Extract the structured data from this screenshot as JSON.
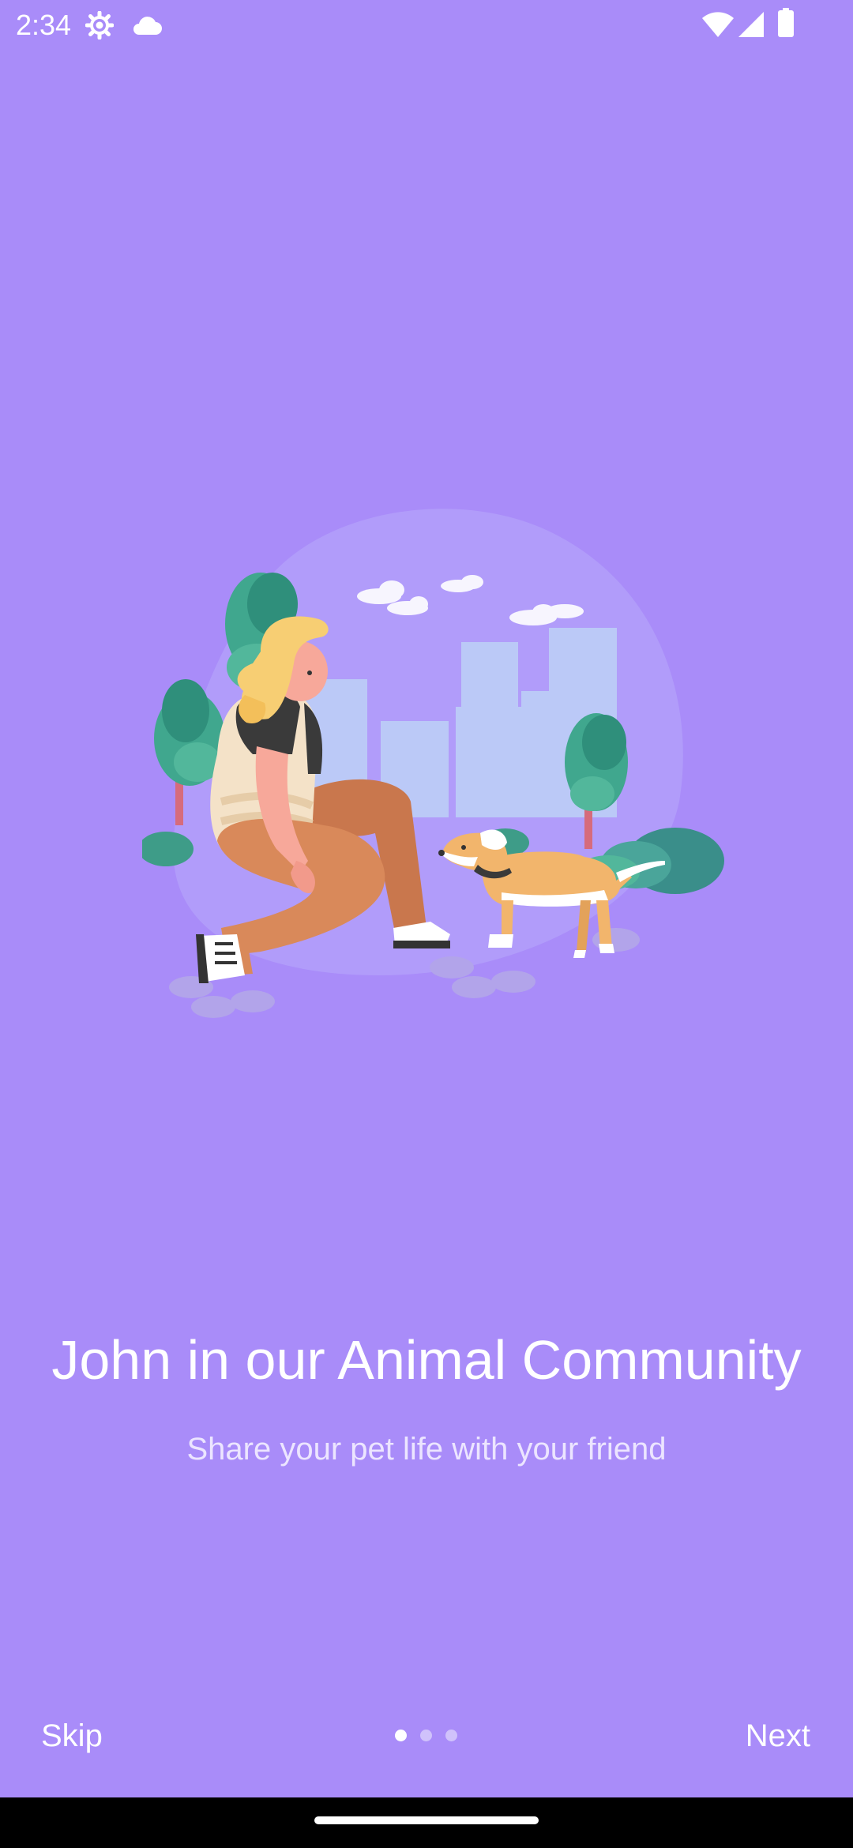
{
  "status_bar": {
    "time": "2:34",
    "icons": [
      "settings-icon",
      "cloud-icon",
      "wifi-icon",
      "signal-icon",
      "battery-icon"
    ]
  },
  "onboarding": {
    "illustration": "woman-petting-dog-in-park-illustration",
    "title": "John in our Animal Community",
    "subtitle": "Share your pet life with your friend",
    "page_indicator": {
      "current": 1,
      "total": 3
    }
  },
  "footer": {
    "skip_label": "Skip",
    "next_label": "Next"
  },
  "colors": {
    "background": "#a98cf9",
    "text": "#ffffff",
    "subtitle": "#ece5ff",
    "dot_inactive": "#d0c2fb",
    "nav_bar": "#000000"
  }
}
